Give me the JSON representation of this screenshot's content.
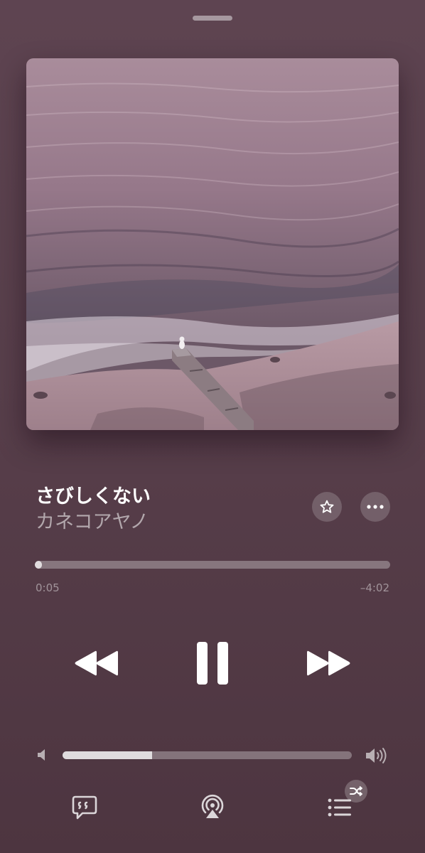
{
  "now_playing": {
    "title": "さびしくない",
    "artist": "カネコアヤノ",
    "progress_fraction": 0.02,
    "time_elapsed": "0:05",
    "time_remaining": "–4:02",
    "volume_fraction": 0.31
  },
  "icons": {
    "grabber": "grabber-handle",
    "artwork": "album-artwork",
    "favorite": "star-icon",
    "more": "ellipsis-icon",
    "rewind": "backward-icon",
    "pause": "pause-icon",
    "forward": "forward-icon",
    "volume_low": "speaker-icon",
    "volume_high": "speaker-wave-icon",
    "lyrics": "lyrics-quote-icon",
    "airplay": "airplay-icon",
    "queue": "list-icon",
    "shuffle": "shuffle-icon"
  },
  "colors": {
    "background": "#5a404c",
    "primary_text": "#ffffff",
    "secondary_text": "#c9b7c0"
  }
}
